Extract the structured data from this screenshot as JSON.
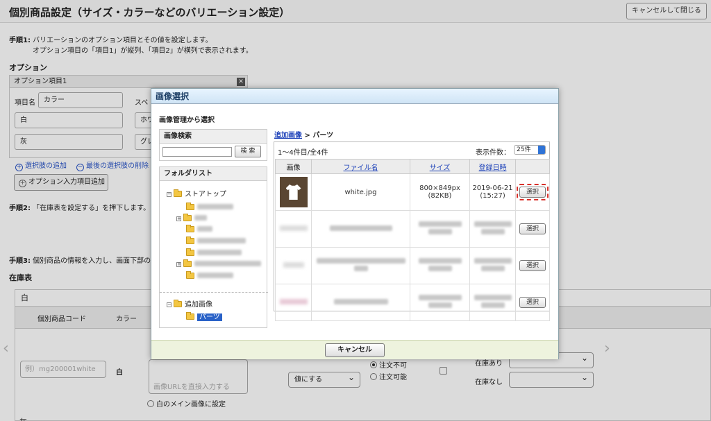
{
  "page": {
    "title": "個別商品設定（サイズ・カラーなどのバリエーション設定）",
    "close_button": "キャンセルして閉じる",
    "step1_label": "手順1:",
    "step1_text": "バリエーションのオプション項目とその値を設定します。",
    "step1_sub": "オプション項目の「項目1」が縦列、「項目2」が横列で表示されます。",
    "options_title": "オプション",
    "option_box": {
      "header": "オプション項目1",
      "item_name_label": "項目名",
      "item_name_value": "カラー",
      "spec_label": "スペ",
      "values": [
        "白",
        "灰"
      ],
      "right_values": [
        "ホワ",
        "グレ"
      ]
    },
    "add_choice_link": "選択肢の追加",
    "remove_choice_link": "最後の選択肢の削除",
    "add_option_button": "オプション入力項目追加",
    "step2_label": "手順2:",
    "step2_text": "「在庫表を設定する」を押下します。",
    "step3_label": "手順3:",
    "step3_text": "個別商品の情報を入力し、画面下部の",
    "stock_title": "在庫表",
    "stock": {
      "color_name": "白",
      "col_code": "個別商品コード",
      "col_color": "カラー",
      "code_placeholder": "例）mg200001white",
      "row_color": "白",
      "image_url_placeholder": "画像URLを直接入力する",
      "main_image_radio": "白のメイン画像に設定",
      "value_select": "値にする",
      "order_disabled": "注文不可",
      "order_enabled": "注文可能",
      "stock_yes_label": "在庫あり",
      "stock_no_label": "在庫なし",
      "next_color": "灰"
    }
  },
  "modal": {
    "title": "画像選択",
    "section_title": "画像管理から選択",
    "search_header": "画像検索",
    "search_button": "検 索",
    "folder_header": "フォルダリスト",
    "folders": {
      "root": "ストアトップ",
      "added": "追加画像",
      "parts": "パーツ"
    },
    "breadcrumb_link": "追加画像",
    "breadcrumb_sep": " > ",
    "breadcrumb_current": "パーツ",
    "count_text": "1〜4件目/全4件",
    "per_page_label": "表示件数：",
    "per_page_value": "25件",
    "columns": {
      "image": "画像",
      "filename": "ファイル名",
      "size": "サイズ",
      "date": "登録日時"
    },
    "rows": [
      {
        "filename": "white.jpg",
        "size": "800×849px",
        "filesize": "(82KB)",
        "date": "2019-06-21",
        "time": "(15:27)",
        "select": "選択"
      },
      {
        "select": "選択"
      },
      {
        "select": "選択"
      },
      {
        "select": "選択"
      }
    ],
    "cancel_button": "キャンセル"
  },
  "colors": {
    "link_blue": "#1a3fb8",
    "highlight_red": "#d9302a",
    "selected_folder": "#2a62c8"
  }
}
